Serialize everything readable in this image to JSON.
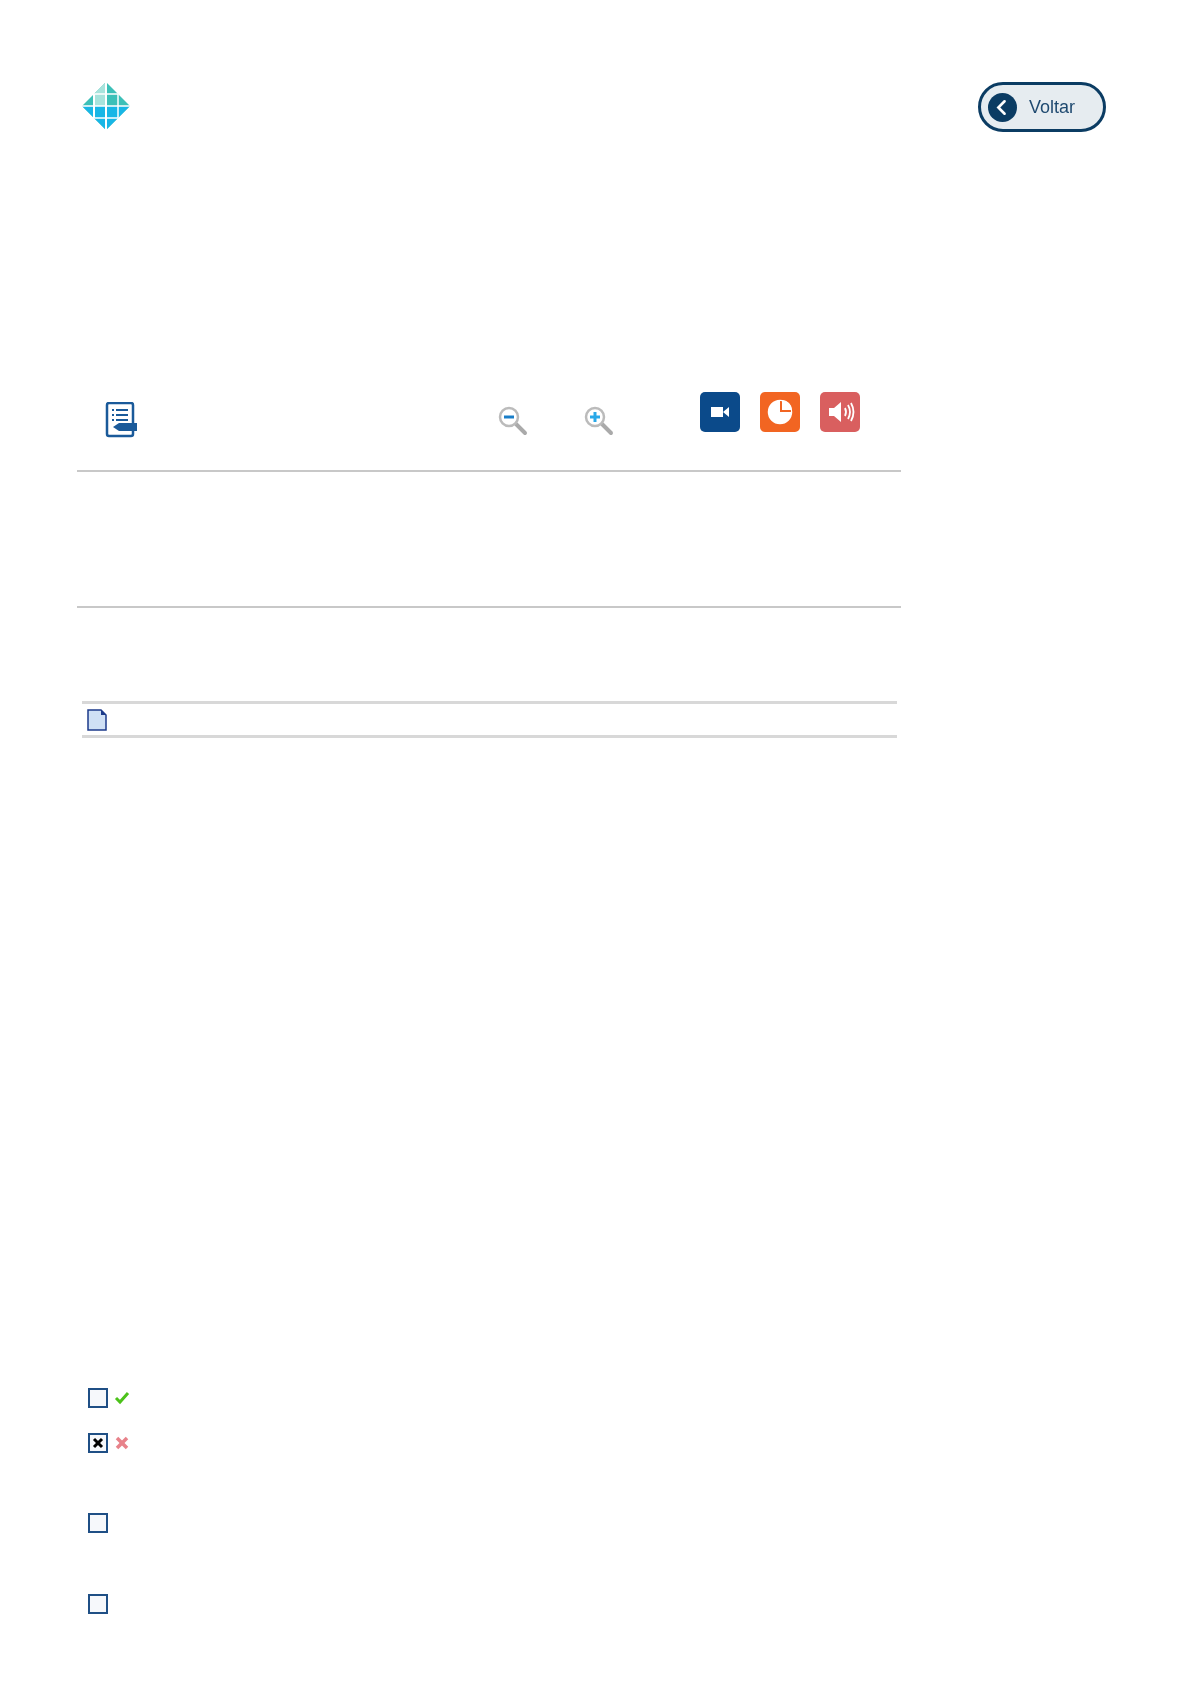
{
  "header": {
    "back_button": "Voltar"
  },
  "options": [
    {
      "checked": false,
      "kind": "correct"
    },
    {
      "checked": true,
      "kind": "wrong"
    },
    {
      "checked": false
    },
    {
      "checked": false
    }
  ]
}
